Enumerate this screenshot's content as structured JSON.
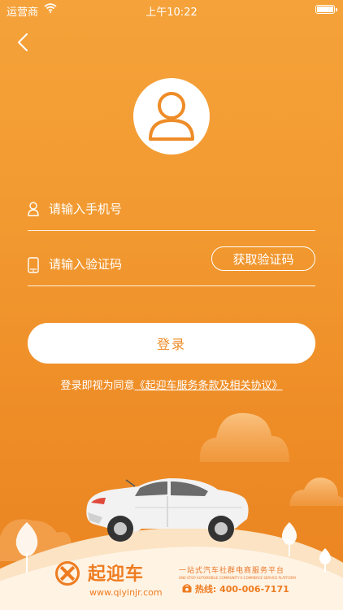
{
  "status_bar": {
    "carrier": "运营商",
    "time": "上午10:22"
  },
  "form": {
    "phone_placeholder": "请输入手机号",
    "code_placeholder": "请输入验证码",
    "get_code_label": "获取验证码",
    "login_label": "登录"
  },
  "agreement": {
    "prefix": "登录即视为同意",
    "link": "《起迎车服务条款及相关协议》"
  },
  "brand": {
    "name": "起迎车",
    "url": "www.qiyinjr.com",
    "slogan_cn": "一站式汽车社群电商服务平台",
    "slogan_en": "ONE-STOP AUTOMOBILE COMMUNITY E-COMMERCE SERVICE PLATFORM",
    "hotline_label": "热线:",
    "hotline_number": "400-006-7171"
  },
  "colors": {
    "background": "#F29A31",
    "accent": "#EE8C28",
    "brand": "#EE7C20"
  },
  "icons": [
    "back-arrow-icon",
    "user-avatar-icon",
    "user-icon",
    "phone-icon",
    "wifi-icon",
    "battery-icon",
    "phone-handset-icon",
    "brand-logo-icon"
  ]
}
